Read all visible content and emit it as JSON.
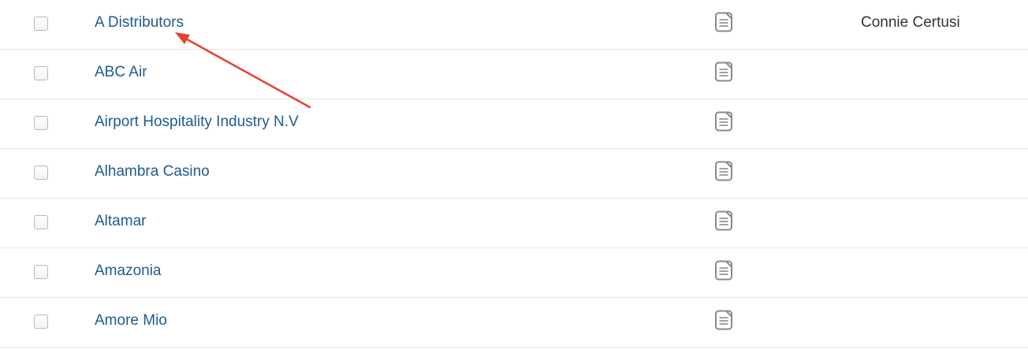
{
  "rows": [
    {
      "name": "A Distributors",
      "owner": "Connie Certusi",
      "icon": "document-icon"
    },
    {
      "name": "ABC Air",
      "owner": "",
      "icon": "document-icon"
    },
    {
      "name": "Airport Hospitality Industry N.V",
      "owner": "",
      "icon": "document-icon"
    },
    {
      "name": "Alhambra Casino",
      "owner": "",
      "icon": "document-icon"
    },
    {
      "name": "Altamar",
      "owner": "",
      "icon": "document-icon"
    },
    {
      "name": "Amazonia",
      "owner": "",
      "icon": "document-icon"
    },
    {
      "name": "Amore Mio",
      "owner": "",
      "icon": "document-icon"
    }
  ],
  "colors": {
    "link": "#1f5b8f",
    "text": "#333333",
    "divider": "#e6e6e6",
    "icon": "#8a8a8a",
    "annotation_arrow": "#e8402f"
  },
  "annotation": {
    "type": "arrow",
    "points_to": "A Distributors"
  }
}
